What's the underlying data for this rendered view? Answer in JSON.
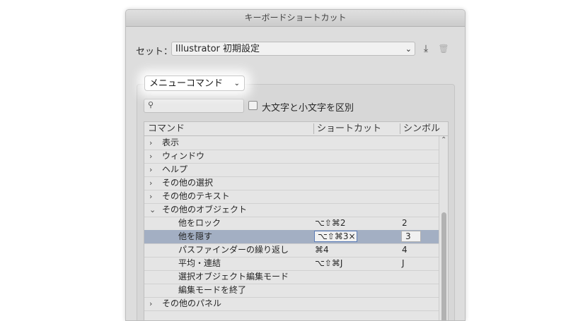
{
  "window": {
    "title": "キーボードショートカット"
  },
  "set": {
    "label": "セット：",
    "value": "Illustrator 初期設定"
  },
  "icons": {
    "chevron": "⌄",
    "export": "⤓",
    "trash": "🗑",
    "search": "⚲",
    "expanded": "⌄",
    "collapsed": "›",
    "scroll_up": "⌃"
  },
  "command_type": {
    "value": "メニューコマンド"
  },
  "search": {
    "value": ""
  },
  "case_option": {
    "label": "大文字と小文字を区別",
    "checked": false
  },
  "table": {
    "headers": [
      "コマンド",
      "ショートカット",
      "シンボル"
    ],
    "rows": [
      {
        "label": "表示",
        "expanded": false
      },
      {
        "label": "ウィンドウ",
        "expanded": false
      },
      {
        "label": "ヘルプ",
        "expanded": false
      },
      {
        "label": "その他の選択",
        "expanded": false
      },
      {
        "label": "その他のテキスト",
        "expanded": false
      },
      {
        "label": "その他のオブジェクト",
        "expanded": true
      },
      {
        "label": "他をロック",
        "shortcut": "⌥⇧⌘2",
        "symbol": "2"
      },
      {
        "label": "他を隠す",
        "shortcut": "⌥⇧⌘3×",
        "symbol": "3",
        "selected": true
      },
      {
        "label": "パスファインダーの繰り返し",
        "shortcut": "⌘4",
        "symbol": "4"
      },
      {
        "label": "平均・連結",
        "shortcut": "⌥⇧⌘J",
        "symbol": "J"
      },
      {
        "label": "選択オブジェクト編集モード"
      },
      {
        "label": "編集モードを終了"
      },
      {
        "label": "その他のパネル",
        "expanded": false
      }
    ]
  }
}
